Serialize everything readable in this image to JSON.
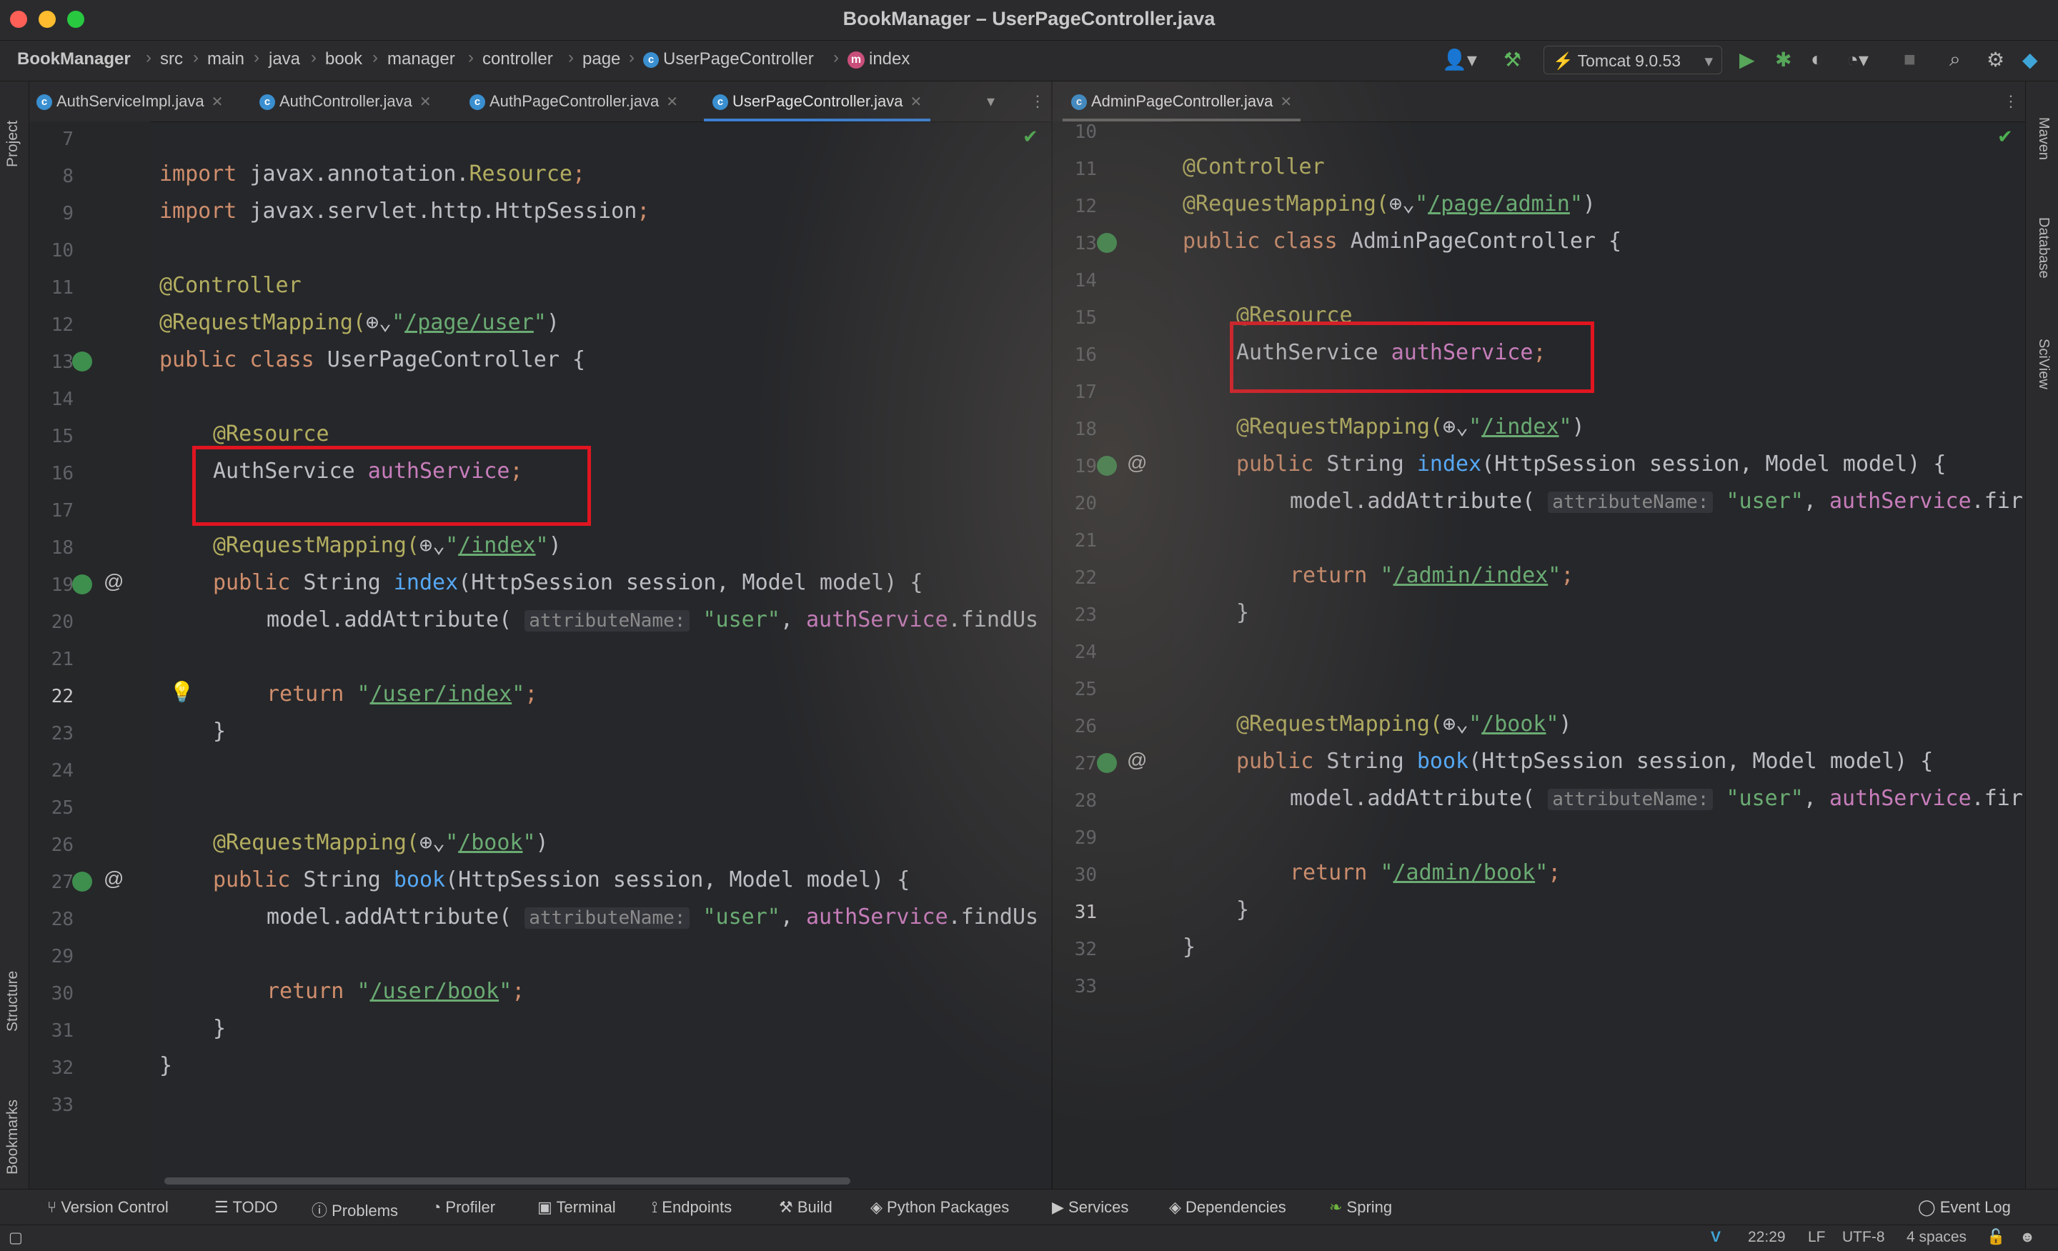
{
  "window": {
    "title": "BookManager – UserPageController.java"
  },
  "nav": {
    "project": "BookManager",
    "crumbs": [
      "src",
      "main",
      "java",
      "book",
      "manager",
      "controller",
      "page"
    ],
    "class_crumb": "UserPageController",
    "method_crumb": "index",
    "run_config": "Tomcat 9.0.53"
  },
  "left_stripe": {
    "project": "Project",
    "structure": "Structure",
    "bookmarks": "Bookmarks"
  },
  "right_stripe": {
    "maven": "Maven",
    "database": "Database",
    "sciview": "SciView"
  },
  "left_editor": {
    "tabs": [
      "AuthServiceImpl.java",
      "AuthController.java",
      "AuthPageController.java",
      "UserPageController.java"
    ],
    "active_tab": "UserPageController.java",
    "lines": [
      "7",
      "8",
      "9",
      "10",
      "11",
      "12",
      "13",
      "14",
      "15",
      "16",
      "17",
      "18",
      "19",
      "20",
      "21",
      "22",
      "23",
      "24",
      "25",
      "26",
      "27",
      "28",
      "29",
      "30",
      "31",
      "32",
      "33"
    ],
    "code": {
      "import1_kw": "import",
      "import1": " javax.annotation.",
      "import1_cls": "Resource",
      "import2_kw": "import",
      "import2": " javax.servlet.http.HttpSession",
      "controller": "@Controller",
      "reqmap": "@RequestMapping(",
      "reqmap_path": "/page/user",
      "class_decl_kw": "public class",
      "class_name": " UserPageController {",
      "resource": "@Resource",
      "field_type": "AuthService ",
      "field_name": "authService",
      "index_path": "/index",
      "public_kw": "public",
      "string_type": " String ",
      "index_fn": "index",
      "params": "(HttpSession session, Model model) {",
      "add_attr": "model.addAttribute(",
      "hint": "attributeName:",
      "user_str": "\"user\"",
      "find_call": "authService",
      "find_rest": ".findUs",
      "return_kw": "return",
      "user_index": "/user/index",
      "book_path": "/book",
      "book_fn": "book",
      "user_book": "/user/book"
    }
  },
  "right_editor": {
    "tabs": [
      "AdminPageController.java"
    ],
    "lines": [
      "10",
      "11",
      "12",
      "13",
      "14",
      "15",
      "16",
      "17",
      "18",
      "19",
      "20",
      "21",
      "22",
      "23",
      "24",
      "25",
      "26",
      "27",
      "28",
      "29",
      "30",
      "31",
      "32",
      "33"
    ],
    "code": {
      "reqmap_path": "/page/admin",
      "class_name": " AdminPageController {",
      "find_rest": ".fir",
      "admin_index": "/admin/index",
      "admin_book": "/admin/book"
    }
  },
  "bottom_tools": [
    "Version Control",
    "TODO",
    "Problems",
    "Profiler",
    "Terminal",
    "Endpoints",
    "Build",
    "Python Packages",
    "Services",
    "Dependencies",
    "Spring"
  ],
  "event_log": "Event Log",
  "status": {
    "time": "22:29",
    "line_sep": "LF",
    "encoding": "UTF-8",
    "indent": "4 spaces"
  }
}
